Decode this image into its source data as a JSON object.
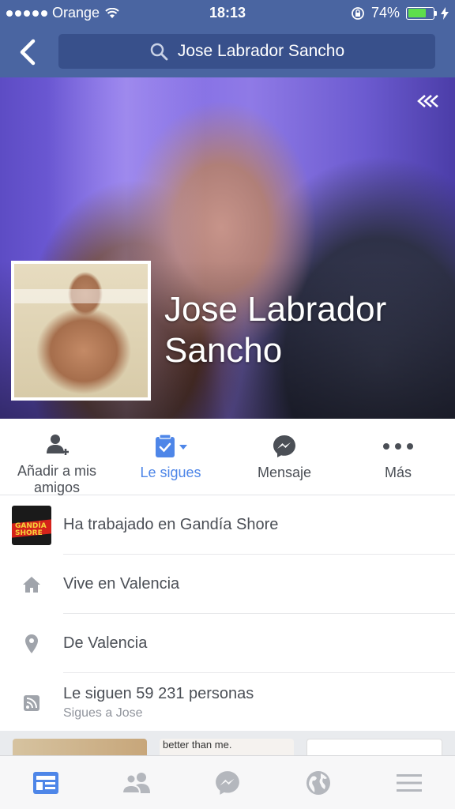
{
  "status_bar": {
    "carrier": "Orange",
    "time": "18:13",
    "battery_percent": "74%",
    "battery_level": 0.74
  },
  "search": {
    "query": "Jose Labrador Sancho"
  },
  "profile": {
    "name": "Jose Labrador Sancho"
  },
  "actions": [
    {
      "label": "Añadir a mis amigos",
      "icon": "add-friend-icon",
      "active": false
    },
    {
      "label": "Le sigues",
      "icon": "following-icon",
      "active": true
    },
    {
      "label": "Mensaje",
      "icon": "messenger-icon",
      "active": false
    },
    {
      "label": "Más",
      "icon": "more-icon",
      "active": false
    }
  ],
  "info": [
    {
      "text": "Ha trabajado en Gandía Shore",
      "icon": "gandia-shore-logo",
      "logo_text": "GANDÍA SHORE"
    },
    {
      "text": "Vive en Valencia",
      "icon": "home-icon"
    },
    {
      "text": "De Valencia",
      "icon": "location-pin-icon"
    },
    {
      "text": "Le siguen 59 231 personas",
      "sub": "Sigues a Jose",
      "icon": "rss-icon"
    }
  ],
  "photo_strip": {
    "caption": "better than me."
  },
  "tabbar": [
    {
      "icon": "news-feed-icon",
      "active": true
    },
    {
      "icon": "friend-requests-icon",
      "active": false
    },
    {
      "icon": "messenger-icon",
      "active": false
    },
    {
      "icon": "notifications-globe-icon",
      "active": false
    },
    {
      "icon": "menu-icon",
      "active": false
    }
  ],
  "colors": {
    "header_blue": "#4a65a1",
    "search_blue": "#38508b",
    "accent": "#4e86e8",
    "battery_green": "#5ede4c"
  }
}
